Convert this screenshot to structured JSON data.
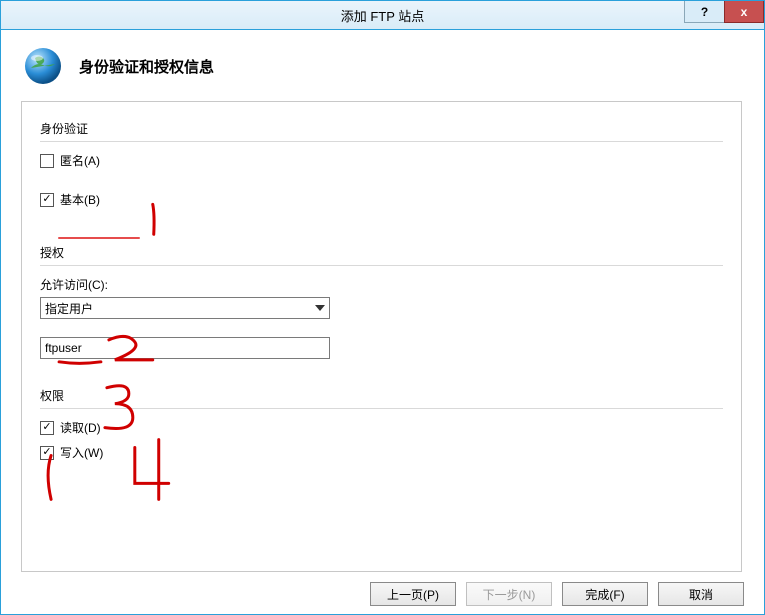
{
  "titlebar": {
    "title": "添加 FTP 站点",
    "help": "?",
    "close": "x"
  },
  "header": {
    "heading": "身份验证和授权信息"
  },
  "auth": {
    "section_title": "身份验证",
    "anonymous_label": "匿名(A)",
    "anonymous_checked": false,
    "basic_label": "基本(B)",
    "basic_checked": true
  },
  "authorization": {
    "section_title": "授权",
    "allow_access_label": "允许访问(C):",
    "allow_access_value": "指定用户",
    "user_value": "ftpuser"
  },
  "permissions": {
    "section_title": "权限",
    "read_label": "读取(D)",
    "read_checked": true,
    "write_label": "写入(W)",
    "write_checked": true
  },
  "footer": {
    "prev": "上一页(P)",
    "next": "下一步(N)",
    "finish": "完成(F)",
    "cancel": "取消"
  },
  "annotations": {
    "n1": "1",
    "n2": "2",
    "n3": "3",
    "n4": "4"
  }
}
